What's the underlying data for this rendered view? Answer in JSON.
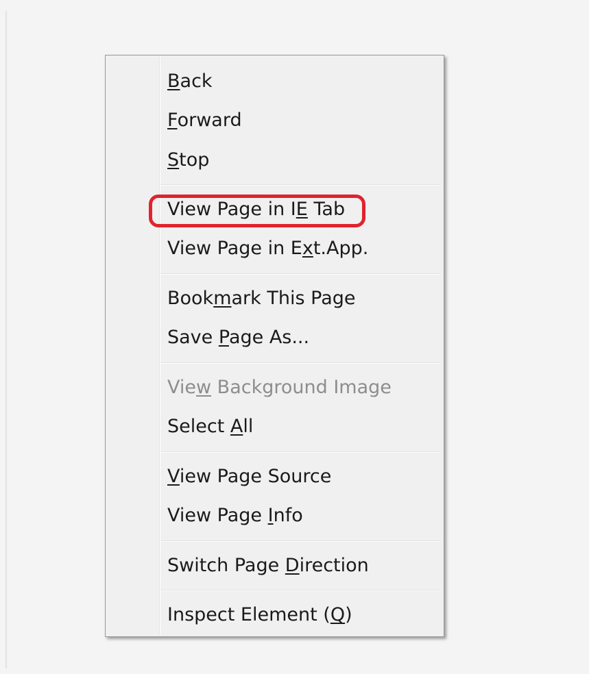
{
  "menu": {
    "items": [
      {
        "label": "Back",
        "pre": "",
        "key": "B",
        "post": "ack",
        "enabled": true
      },
      {
        "label": "Forward",
        "pre": "",
        "key": "F",
        "post": "orward",
        "enabled": true
      },
      {
        "label": "Stop",
        "pre": "",
        "key": "S",
        "post": "top",
        "enabled": true
      },
      {
        "label": "View Page in IE Tab",
        "pre": "View Page in I",
        "key": "E",
        "post": " Tab",
        "enabled": true,
        "highlighted": true
      },
      {
        "label": "View Page in Ext.App.",
        "pre": "View Page in E",
        "key": "x",
        "post": "t.App.",
        "enabled": true
      },
      {
        "label": "Bookmark This Page",
        "pre": "Book",
        "key": "m",
        "post": "ark This Page",
        "enabled": true
      },
      {
        "label": "Save Page As...",
        "pre": "Save ",
        "key": "P",
        "post": "age As...",
        "enabled": true
      },
      {
        "label": "View Background Image",
        "pre": "Vie",
        "key": "w",
        "post": " Background Image",
        "enabled": false
      },
      {
        "label": "Select All",
        "pre": "Select ",
        "key": "A",
        "post": "ll",
        "enabled": true
      },
      {
        "label": "View Page Source",
        "pre": "",
        "key": "V",
        "post": "iew Page Source",
        "enabled": true
      },
      {
        "label": "View Page Info",
        "pre": "View Page ",
        "key": "I",
        "post": "nfo",
        "enabled": true
      },
      {
        "label": "Switch Page Direction",
        "pre": "Switch Page ",
        "key": "D",
        "post": "irection",
        "enabled": true
      },
      {
        "label": "Inspect Element (Q)",
        "pre": "Inspect Element (",
        "key": "Q",
        "post": ")",
        "enabled": true
      }
    ],
    "highlight_color": "#e0232e"
  }
}
